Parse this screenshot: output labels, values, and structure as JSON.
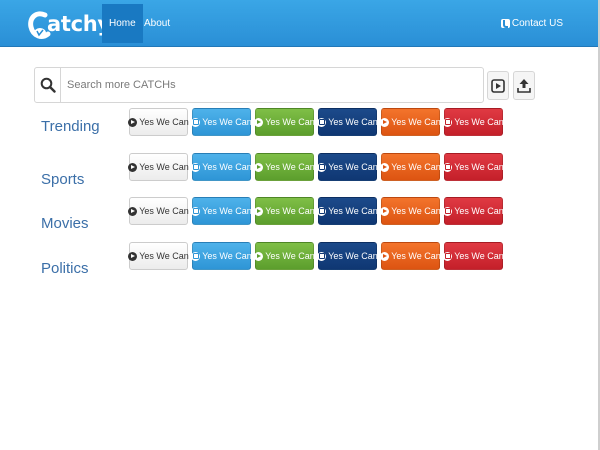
{
  "navbar": {
    "logo_text": "atchy",
    "nav_items": [
      {
        "label": "Home",
        "active": true
      },
      {
        "label": "About",
        "active": false
      }
    ],
    "contact_label": "Contact US",
    "contact_icon": "phone-icon",
    "bar_color": "#2a8fd6",
    "active_color": "#1979c2"
  },
  "search": {
    "placeholder": "Search more CATCHs",
    "value": "",
    "search_icon": "search-icon",
    "actions": [
      {
        "icon": "play-icon"
      },
      {
        "icon": "upload-icon"
      }
    ]
  },
  "categories": [
    {
      "label": "Trending"
    },
    {
      "label": "Sports"
    },
    {
      "label": "Movies"
    },
    {
      "label": "Politics"
    }
  ],
  "button_rows": [
    {
      "buttons": [
        {
          "label": "Yes We Can",
          "style": "default",
          "icon": "play-circle-icon"
        },
        {
          "label": "Yes We Can",
          "style": "primary",
          "icon": "stop-circle-icon"
        },
        {
          "label": "Yes We Can",
          "style": "success",
          "icon": "play-circle-icon"
        },
        {
          "label": "Yes We Can",
          "style": "info",
          "icon": "stop-circle-icon"
        },
        {
          "label": "Yes We Can",
          "style": "warning",
          "icon": "play-circle-icon"
        },
        {
          "label": "Yes We Can",
          "style": "danger",
          "icon": "stop-circle-icon"
        }
      ]
    },
    {
      "buttons": [
        {
          "label": "Yes We Can",
          "style": "default",
          "icon": "play-circle-icon"
        },
        {
          "label": "Yes We Can",
          "style": "primary",
          "icon": "stop-circle-icon"
        },
        {
          "label": "Yes We Can",
          "style": "success",
          "icon": "play-circle-icon"
        },
        {
          "label": "Yes We Can",
          "style": "info",
          "icon": "stop-circle-icon"
        },
        {
          "label": "Yes We Can",
          "style": "warning",
          "icon": "play-circle-icon"
        },
        {
          "label": "Yes We Can",
          "style": "danger",
          "icon": "stop-circle-icon"
        }
      ]
    },
    {
      "buttons": [
        {
          "label": "Yes We Can",
          "style": "default",
          "icon": "play-circle-icon"
        },
        {
          "label": "Yes We Can",
          "style": "primary",
          "icon": "stop-circle-icon"
        },
        {
          "label": "Yes We Can",
          "style": "success",
          "icon": "play-circle-icon"
        },
        {
          "label": "Yes We Can",
          "style": "info",
          "icon": "stop-circle-icon"
        },
        {
          "label": "Yes We Can",
          "style": "warning",
          "icon": "play-circle-icon"
        },
        {
          "label": "Yes We Can",
          "style": "danger",
          "icon": "stop-circle-icon"
        }
      ]
    },
    {
      "buttons": [
        {
          "label": "Yes We Can",
          "style": "default",
          "icon": "play-circle-icon"
        },
        {
          "label": "Yes We Can",
          "style": "primary",
          "icon": "stop-circle-icon"
        },
        {
          "label": "Yes We Can",
          "style": "success",
          "icon": "play-circle-icon"
        },
        {
          "label": "Yes We Can",
          "style": "info",
          "icon": "stop-circle-icon"
        },
        {
          "label": "Yes We Can",
          "style": "warning",
          "icon": "play-circle-icon"
        },
        {
          "label": "Yes We Can",
          "style": "danger",
          "icon": "stop-circle-icon"
        }
      ]
    }
  ],
  "colors": {
    "default": "#f5f5f5",
    "primary": "#2e95d6",
    "success": "#5c9e2d",
    "info": "#0f3773",
    "warning": "#dd5412",
    "danger": "#c4202a",
    "category_text": "#3b6fa8"
  }
}
